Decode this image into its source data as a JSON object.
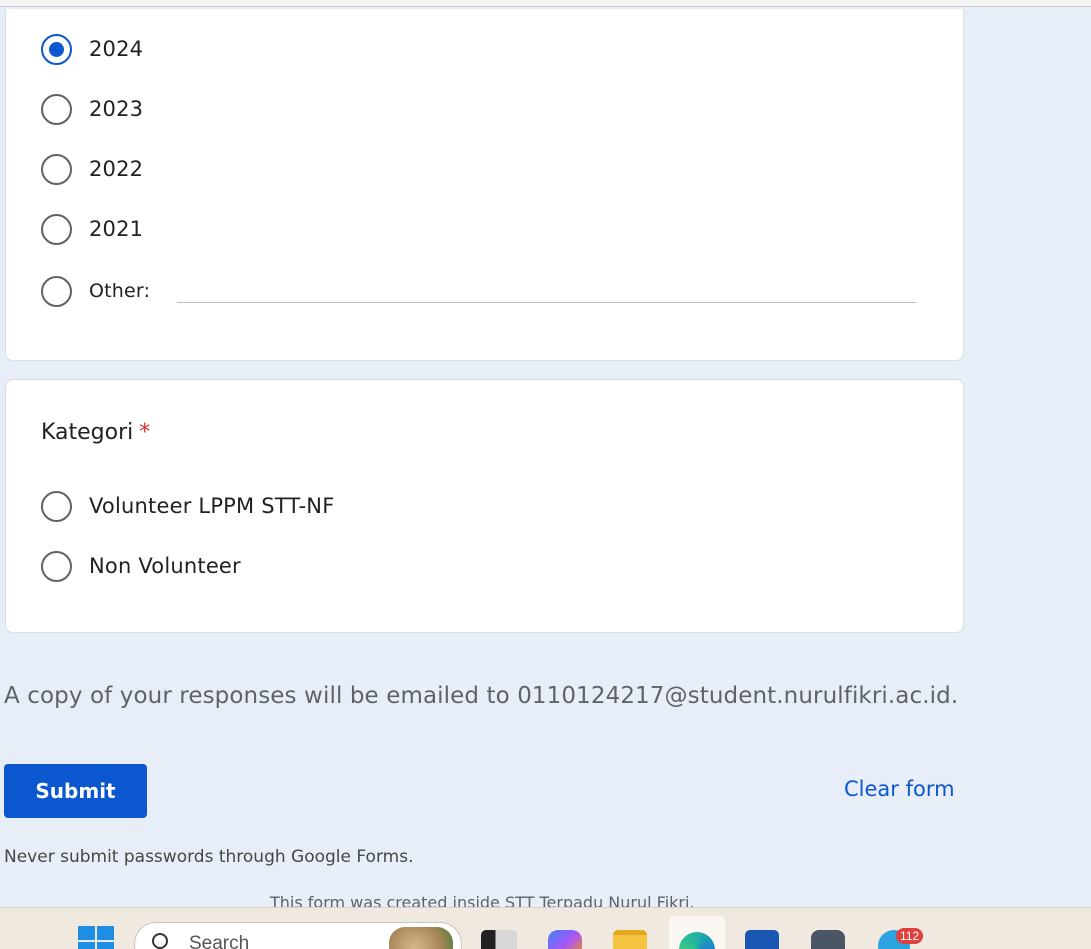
{
  "year_question": {
    "options": [
      "2024",
      "2023",
      "2022",
      "2021"
    ],
    "selected": "2024",
    "other_label": "Other:"
  },
  "kategori_question": {
    "title": "Kategori",
    "required_mark": "*",
    "options": [
      "Volunteer LPPM STT-NF",
      "Non Volunteer"
    ]
  },
  "footer": {
    "email_note": "A copy of your responses will be emailed to 0110124217@student.nurulfikri.ac.id.",
    "submit_label": "Submit",
    "clear_label": "Clear form",
    "password_warning": "Never submit passwords through Google Forms.",
    "created_note": "This form was created inside STT Terpadu Nurul Fikri."
  },
  "taskbar": {
    "search_placeholder": "Search",
    "telegram_badge": "112"
  },
  "colors": {
    "accent": "#0b57d0",
    "page_bg": "#e8eef8",
    "required": "#d93025"
  }
}
